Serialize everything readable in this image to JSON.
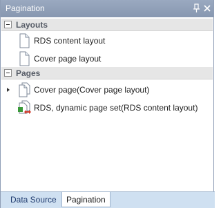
{
  "panel": {
    "title": "Pagination",
    "pin_glyph": "⌂",
    "close_glyph": "✕"
  },
  "groups": [
    {
      "label": "Layouts",
      "items": [
        {
          "label": "RDS content layout",
          "icon": "page-icon"
        },
        {
          "label": "Cover page layout",
          "icon": "page-icon"
        }
      ]
    },
    {
      "label": "Pages",
      "items": [
        {
          "label": "Cover page(Cover page layout)",
          "icon": "pages-stack-icon"
        },
        {
          "label": "RDS, dynamic page set(RDS content layout)",
          "icon": "dynamic-page-set-icon"
        }
      ]
    }
  ],
  "tabs": [
    {
      "label": "Data Source",
      "active": false
    },
    {
      "label": "Pagination",
      "active": true
    }
  ],
  "colors": {
    "titlebar": "#8e9db5",
    "group_header": "#e6e6e6",
    "tabstrip": "#cfe0f1"
  }
}
